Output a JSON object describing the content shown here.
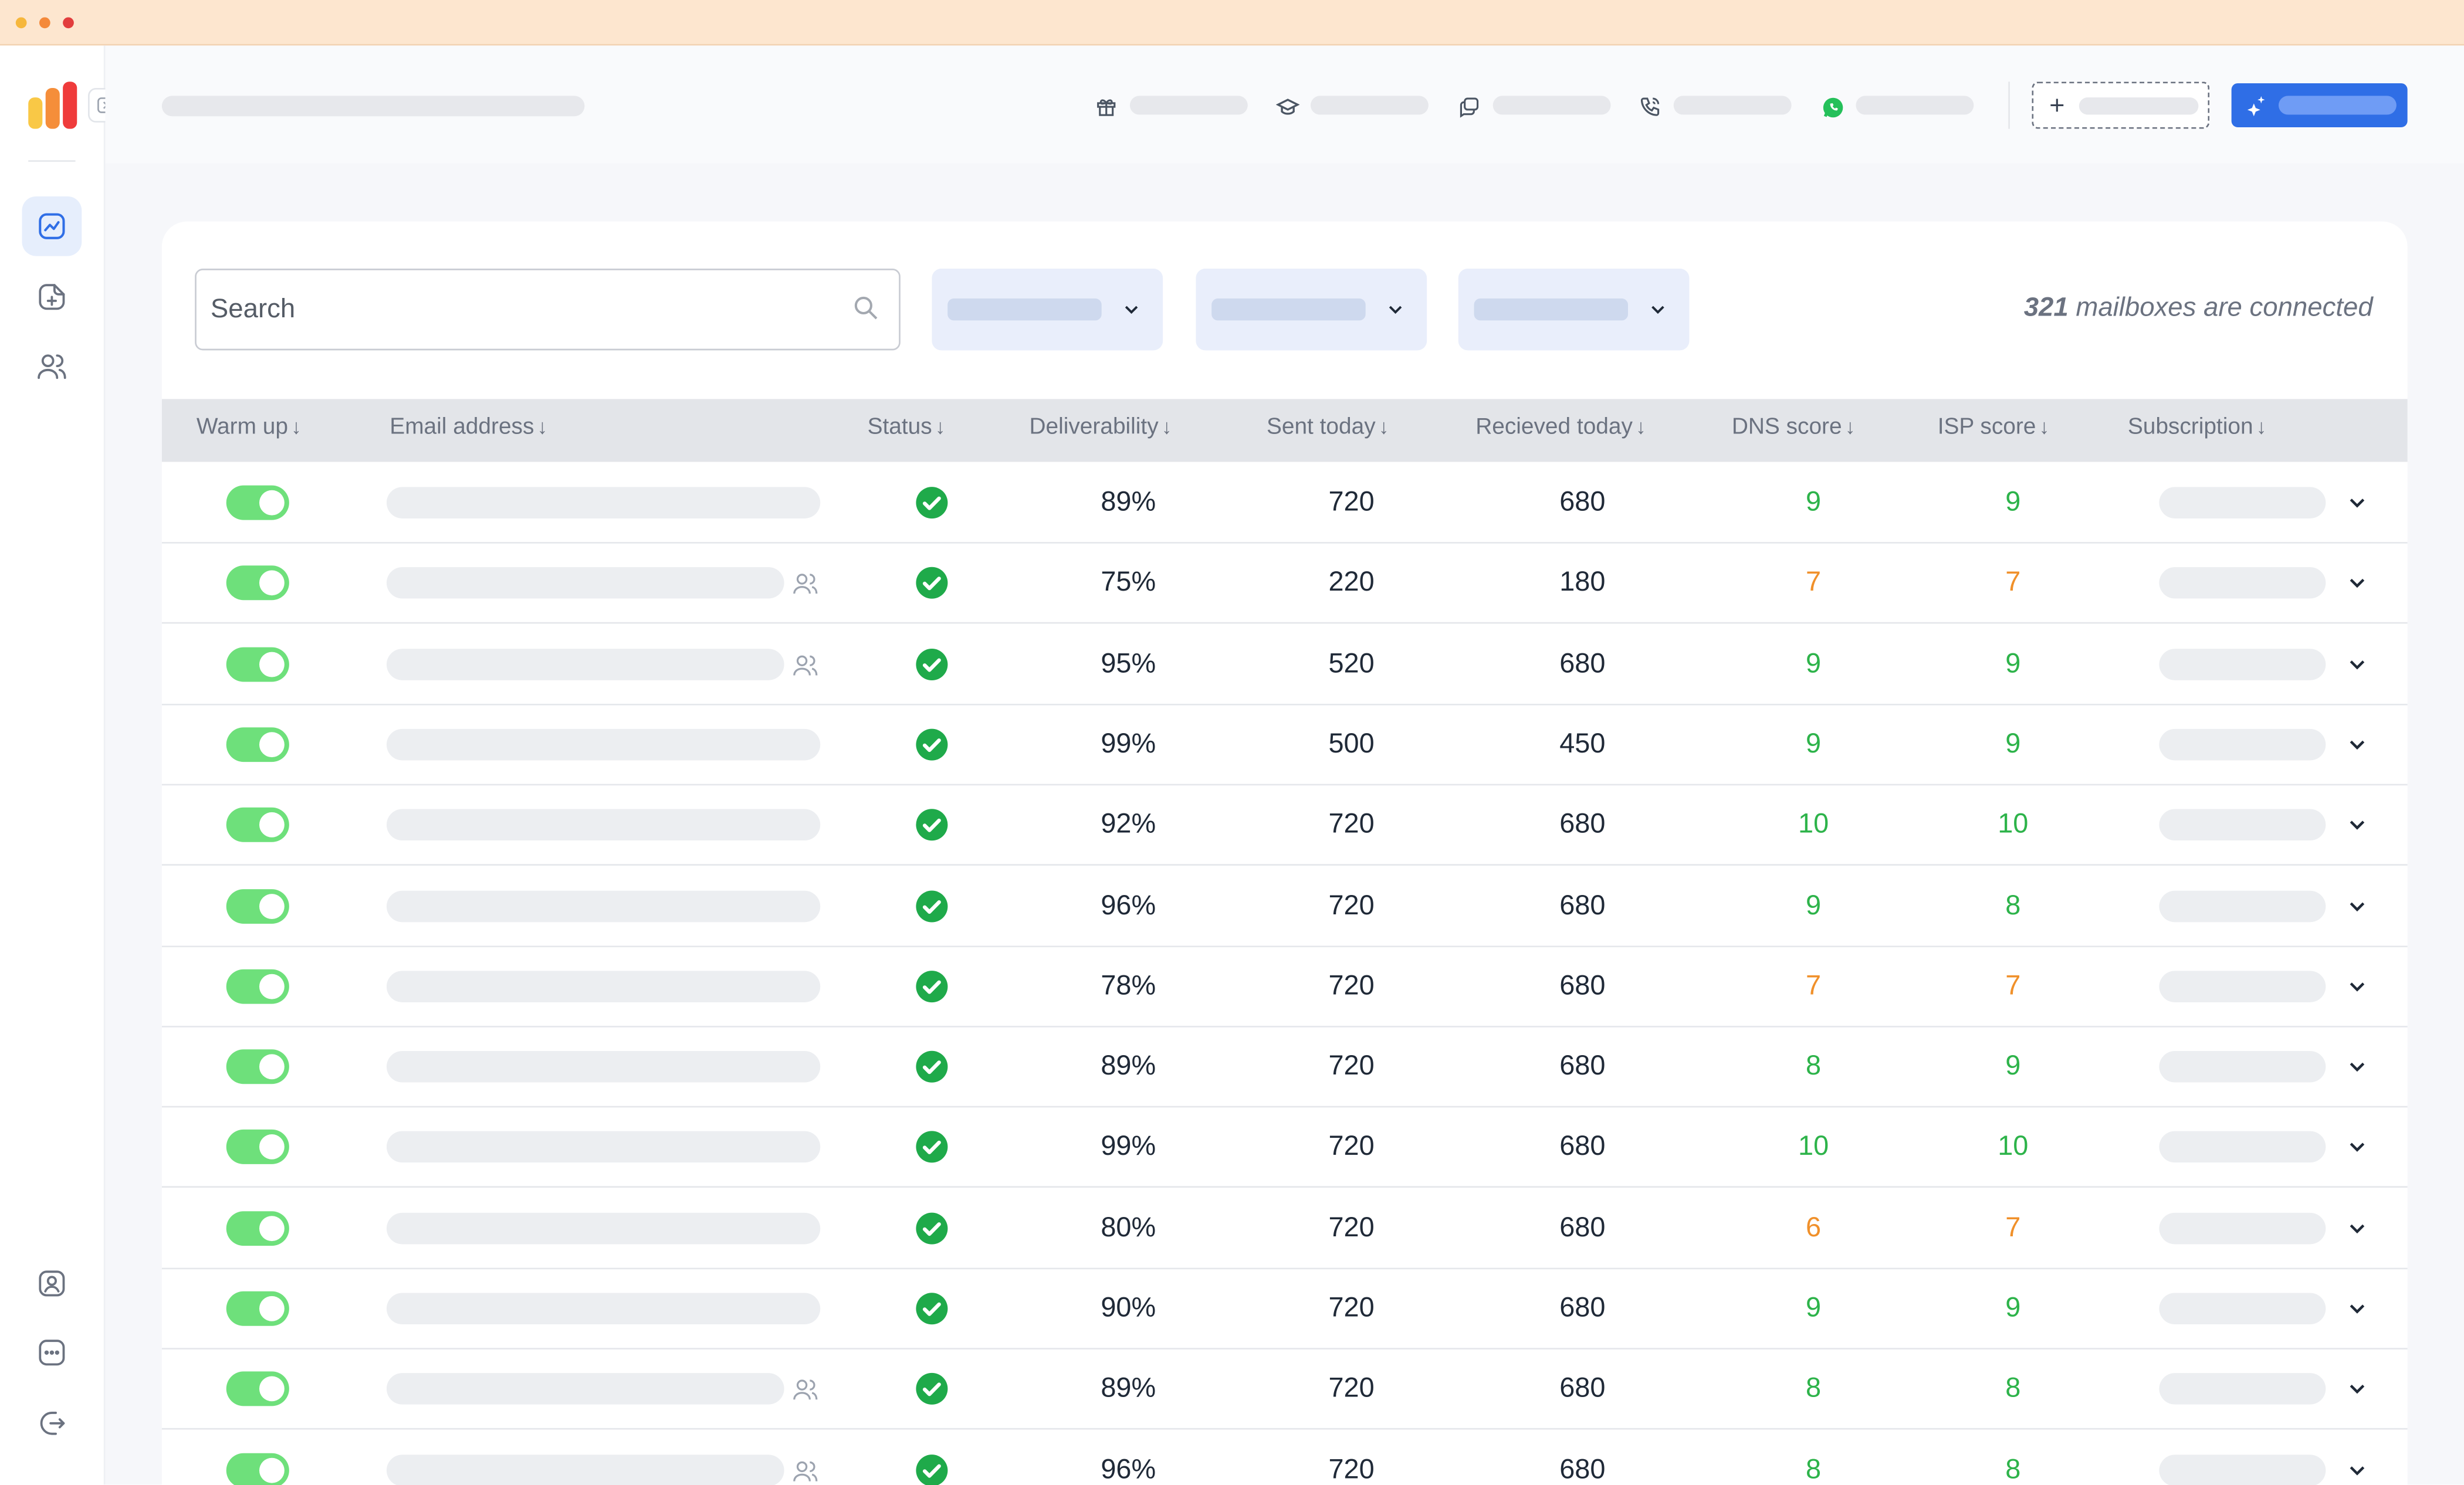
{
  "window": {
    "dots": [
      "#f6b73c",
      "#f4893a",
      "#e23d3d"
    ],
    "titlebar_color": "#fde6cf"
  },
  "sidebar": {
    "logo_bars": [
      "#f9c846",
      "#f58e3a",
      "#ef3b3b"
    ],
    "nav_top": [
      "analytics-icon",
      "add-document-icon",
      "users-icon"
    ],
    "nav_bottom": [
      "profile-icon",
      "chat-icon",
      "logout-icon"
    ]
  },
  "topbar": {
    "icons": [
      "gift-icon",
      "graduation-cap-icon",
      "messages-icon",
      "phone-icon",
      "whatsapp-icon"
    ],
    "add_icon": "plus-icon",
    "ai_icon": "sparkles-icon"
  },
  "filters": {
    "search_placeholder": "Search",
    "dropdown_icon": "chevron-down-icon"
  },
  "summary": {
    "count": "321",
    "text": "mailboxes are connected"
  },
  "table": {
    "columns": [
      "Warm up",
      "Email address",
      "Status",
      "Deliverability",
      "Sent today",
      "Recieved today",
      "DNS score",
      "ISP score",
      "Subscription"
    ],
    "sort_icon": "↓",
    "rows": [
      {
        "warm": true,
        "group": false,
        "deliverability": "89%",
        "sent": "720",
        "received": "680",
        "dns": "9",
        "isp": "9"
      },
      {
        "warm": true,
        "group": true,
        "deliverability": "75%",
        "sent": "220",
        "received": "180",
        "dns": "7",
        "isp": "7"
      },
      {
        "warm": true,
        "group": true,
        "deliverability": "95%",
        "sent": "520",
        "received": "680",
        "dns": "9",
        "isp": "9"
      },
      {
        "warm": true,
        "group": false,
        "deliverability": "99%",
        "sent": "500",
        "received": "450",
        "dns": "9",
        "isp": "9"
      },
      {
        "warm": true,
        "group": false,
        "deliverability": "92%",
        "sent": "720",
        "received": "680",
        "dns": "10",
        "isp": "10"
      },
      {
        "warm": true,
        "group": false,
        "deliverability": "96%",
        "sent": "720",
        "received": "680",
        "dns": "9",
        "isp": "8"
      },
      {
        "warm": true,
        "group": false,
        "deliverability": "78%",
        "sent": "720",
        "received": "680",
        "dns": "7",
        "isp": "7"
      },
      {
        "warm": true,
        "group": false,
        "deliverability": "89%",
        "sent": "720",
        "received": "680",
        "dns": "8",
        "isp": "9"
      },
      {
        "warm": true,
        "group": false,
        "deliverability": "99%",
        "sent": "720",
        "received": "680",
        "dns": "10",
        "isp": "10"
      },
      {
        "warm": true,
        "group": false,
        "deliverability": "80%",
        "sent": "720",
        "received": "680",
        "dns": "6",
        "isp": "7"
      },
      {
        "warm": true,
        "group": false,
        "deliverability": "90%",
        "sent": "720",
        "received": "680",
        "dns": "9",
        "isp": "9"
      },
      {
        "warm": true,
        "group": true,
        "deliverability": "89%",
        "sent": "720",
        "received": "680",
        "dns": "8",
        "isp": "8"
      },
      {
        "warm": true,
        "group": true,
        "deliverability": "96%",
        "sent": "720",
        "received": "680",
        "dns": "8",
        "isp": "8"
      }
    ],
    "score_colors": {
      "high": "#2db34a",
      "mid": "#f0902a"
    }
  }
}
